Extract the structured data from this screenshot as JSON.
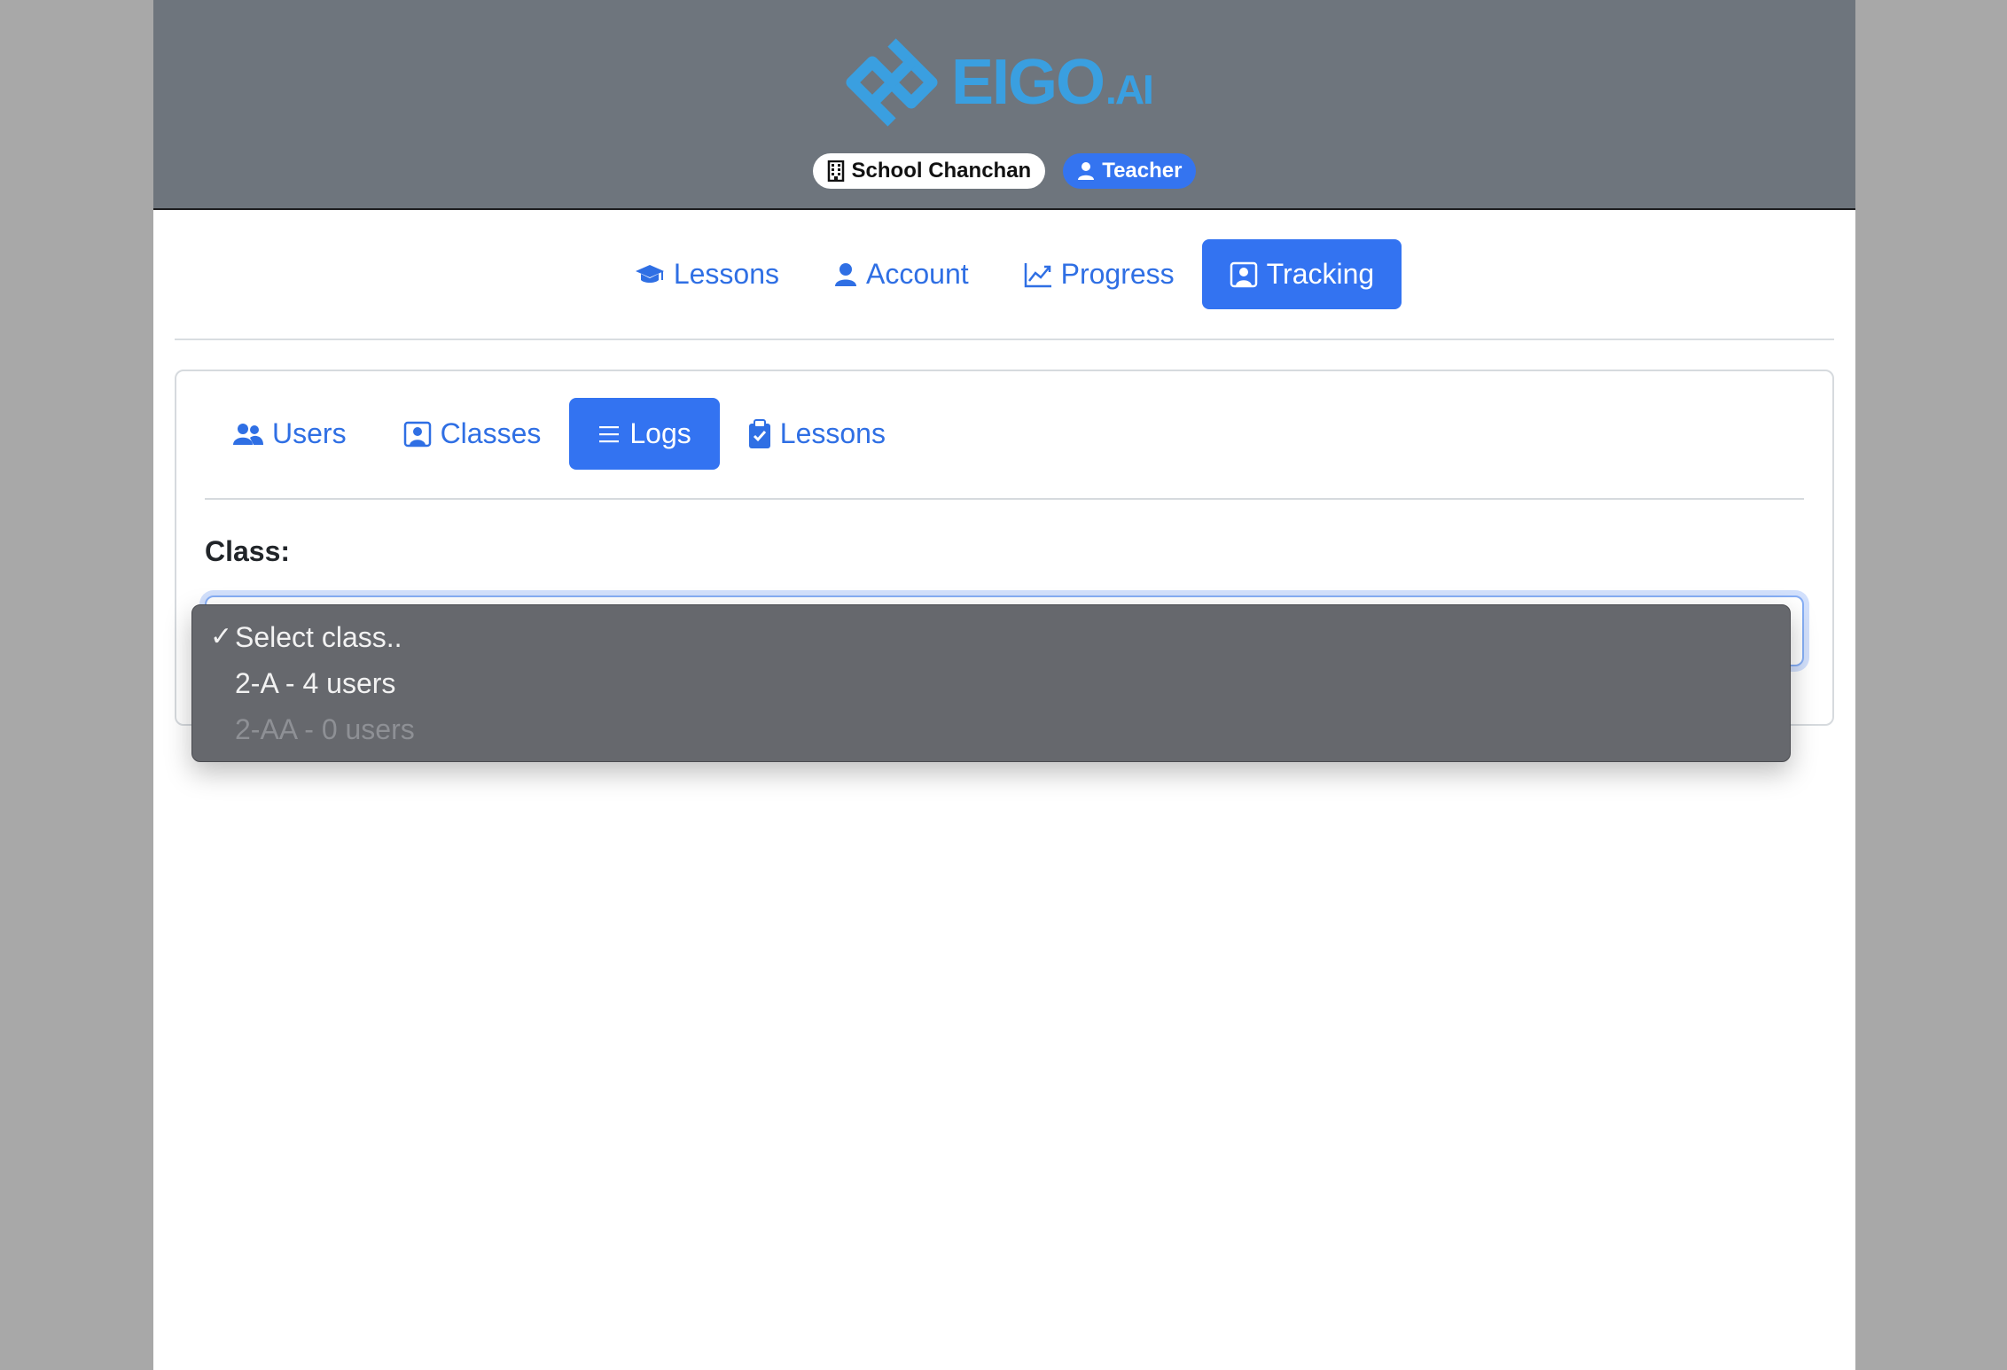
{
  "brand": {
    "name": "EIGO",
    "suffix": ".AI",
    "color": "#3a9fe0"
  },
  "header": {
    "school_badge": {
      "icon": "building-icon",
      "label": "School Chanchan"
    },
    "role_badge": {
      "icon": "person-icon",
      "label": "Teacher"
    }
  },
  "main_nav": [
    {
      "icon": "graduation-cap-icon",
      "label": "Lessons",
      "active": false
    },
    {
      "icon": "person-icon",
      "label": "Account",
      "active": false
    },
    {
      "icon": "chart-line-icon",
      "label": "Progress",
      "active": false
    },
    {
      "icon": "person-square-icon",
      "label": "Tracking",
      "active": true
    }
  ],
  "sub_nav": [
    {
      "icon": "people-icon",
      "label": "Users",
      "active": false
    },
    {
      "icon": "person-square-icon",
      "label": "Classes",
      "active": false
    },
    {
      "icon": "list-icon",
      "label": "Logs",
      "active": true
    },
    {
      "icon": "clipboard-check-icon",
      "label": "Lessons",
      "active": false
    }
  ],
  "class_filter": {
    "label": "Class:",
    "options": [
      {
        "label": "Select class..",
        "selected": true,
        "disabled": false
      },
      {
        "label": "2-A - 4 users",
        "selected": false,
        "disabled": false
      },
      {
        "label": "2-AA - 0 users",
        "selected": false,
        "disabled": true
      }
    ],
    "check_mark": "✓"
  },
  "colors": {
    "accent": "#3373f1",
    "header_bg": "#6e757d",
    "dropdown_bg": "#66686d"
  }
}
